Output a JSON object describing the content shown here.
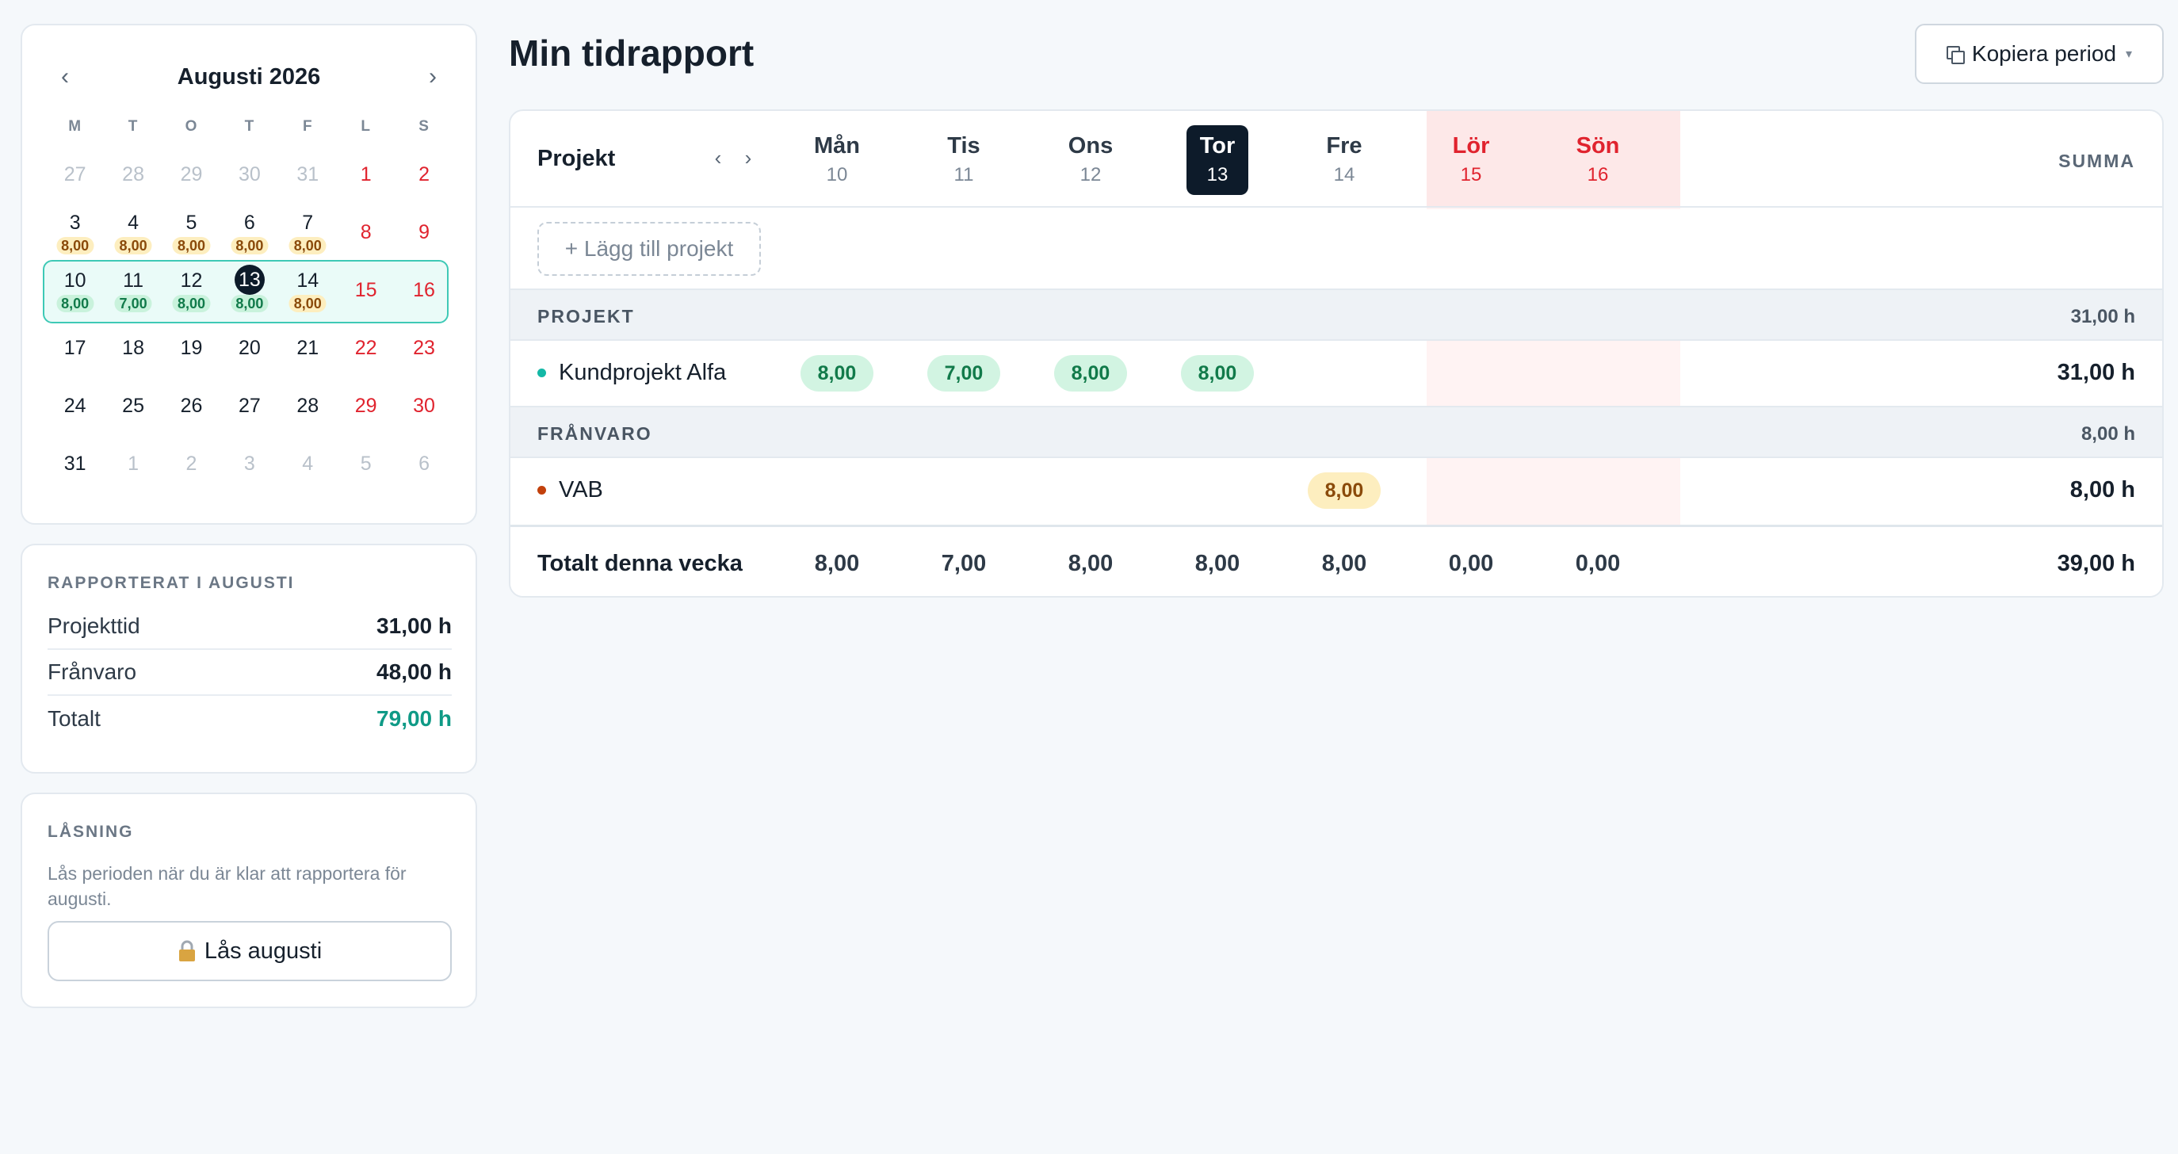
{
  "calendar": {
    "title": "Augusti 2026",
    "prev": "‹",
    "next": "›",
    "dows": [
      "M",
      "T",
      "O",
      "T",
      "F",
      "L",
      "S"
    ],
    "weeks": [
      [
        {
          "d": "27",
          "s": "muted"
        },
        {
          "d": "28",
          "s": "muted"
        },
        {
          "d": "29",
          "s": "muted"
        },
        {
          "d": "30",
          "s": "muted"
        },
        {
          "d": "31",
          "s": "muted"
        },
        {
          "d": "1",
          "s": "weekend"
        },
        {
          "d": "2",
          "s": "weekend"
        }
      ],
      [
        {
          "d": "3",
          "h": "8,00",
          "p": "amber"
        },
        {
          "d": "4",
          "h": "8,00",
          "p": "amber"
        },
        {
          "d": "5",
          "h": "8,00",
          "p": "amber"
        },
        {
          "d": "6",
          "h": "8,00",
          "p": "amber"
        },
        {
          "d": "7",
          "h": "8,00",
          "p": "amber"
        },
        {
          "d": "8",
          "s": "weekend"
        },
        {
          "d": "9",
          "s": "weekend"
        }
      ],
      [
        {
          "d": "10",
          "h": "8,00",
          "p": "green"
        },
        {
          "d": "11",
          "h": "7,00",
          "p": "green"
        },
        {
          "d": "12",
          "h": "8,00",
          "p": "green"
        },
        {
          "d": "13",
          "h": "8,00",
          "p": "green",
          "s": "today"
        },
        {
          "d": "14",
          "h": "8,00",
          "p": "amber"
        },
        {
          "d": "15",
          "s": "weekend"
        },
        {
          "d": "16",
          "s": "weekend"
        }
      ],
      [
        {
          "d": "17"
        },
        {
          "d": "18"
        },
        {
          "d": "19"
        },
        {
          "d": "20"
        },
        {
          "d": "21"
        },
        {
          "d": "22",
          "s": "weekend"
        },
        {
          "d": "23",
          "s": "weekend"
        }
      ],
      [
        {
          "d": "24"
        },
        {
          "d": "25"
        },
        {
          "d": "26"
        },
        {
          "d": "27"
        },
        {
          "d": "28"
        },
        {
          "d": "29",
          "s": "weekend"
        },
        {
          "d": "30",
          "s": "weekend"
        }
      ],
      [
        {
          "d": "31"
        },
        {
          "d": "1",
          "s": "muted"
        },
        {
          "d": "2",
          "s": "muted"
        },
        {
          "d": "3",
          "s": "muted"
        },
        {
          "d": "4",
          "s": "muted"
        },
        {
          "d": "5",
          "s": "muted"
        },
        {
          "d": "6",
          "s": "muted"
        }
      ]
    ],
    "current_week_index": 2
  },
  "reported": {
    "title": "RAPPORTERAT I AUGUSTI",
    "rows": [
      {
        "label": "Projekttid",
        "value": "31,00 h"
      },
      {
        "label": "Frånvaro",
        "value": "48,00 h"
      },
      {
        "label": "Totalt",
        "value": "79,00 h"
      }
    ]
  },
  "lock": {
    "title": "LÅSNING",
    "description": "Lås perioden när du är klar att rapportera för augusti.",
    "icon": "lock-icon",
    "button": "Lås augusti"
  },
  "page": {
    "title": "Min tidrapport",
    "copy_button": "Kopiera period",
    "copy_icon": "copy-icon",
    "caret": "▾"
  },
  "grid": {
    "project_header": "Projekt",
    "nav_prev": "‹",
    "nav_next": "›",
    "sum_header": "SUMMA",
    "days": [
      {
        "name": "Mån",
        "num": "10"
      },
      {
        "name": "Tis",
        "num": "11"
      },
      {
        "name": "Ons",
        "num": "12"
      },
      {
        "name": "Tor",
        "num": "13",
        "today": true
      },
      {
        "name": "Fre",
        "num": "14"
      },
      {
        "name": "Lör",
        "num": "15",
        "weekend": true
      },
      {
        "name": "Sön",
        "num": "16",
        "weekend": true
      }
    ],
    "add_project": "+ Lägg till projekt",
    "groups": [
      {
        "label": "PROJEKT",
        "total": "31,00 h",
        "items": [
          {
            "name": "Kundprojekt Alfa",
            "dot_color": "#14b8a6",
            "pill": "green",
            "cells": [
              "8,00",
              "7,00",
              "8,00",
              "8,00",
              "",
              "",
              ""
            ],
            "sum": "31,00 h"
          }
        ]
      },
      {
        "label": "FRÅNVARO",
        "total": "8,00 h",
        "items": [
          {
            "name": "VAB",
            "dot_color": "#c2410c",
            "pill": "amber",
            "cells": [
              "",
              "",
              "",
              "",
              "8,00",
              "",
              ""
            ],
            "sum": "8,00 h"
          }
        ]
      }
    ],
    "total": {
      "label": "Totalt denna vecka",
      "cells": [
        "8,00",
        "7,00",
        "8,00",
        "8,00",
        "8,00",
        "0,00",
        "0,00"
      ],
      "sum": "39,00 h"
    }
  },
  "colors": {
    "accent_teal": "#0f9a86",
    "weekend_red": "#e0232e",
    "today_navy": "#0d1b2a",
    "hours_green_bg": "#d2f4e2",
    "hours_amber_bg": "#fdeebf"
  }
}
